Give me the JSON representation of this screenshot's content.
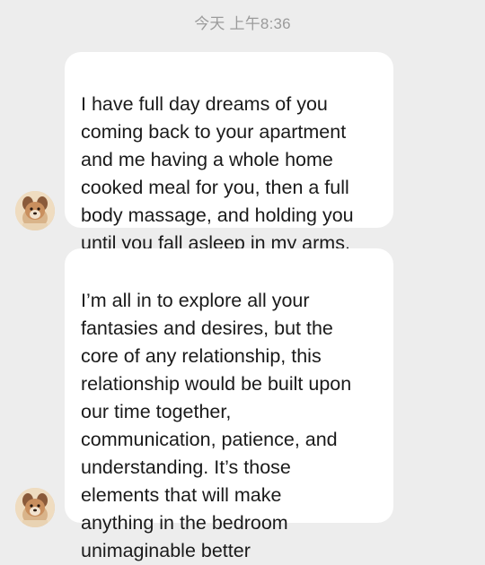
{
  "timestamp": "今天 上午8:36",
  "messages": [
    {
      "sender": "other",
      "avatar": "dog-avatar",
      "text": "I have full day dreams of you\ncoming back to your apartment\nand me having a whole home\ncooked meal for you, then a full\nbody massage, and holding you\nuntil you fall asleep in my arms."
    },
    {
      "sender": "other",
      "avatar": "dog-avatar",
      "text": "I’m all in to explore all your\nfantasies and desires, but the\ncore of any relationship, this\nrelationship would be built upon\nour time together,\ncommunication, patience, and\nunderstanding. It’s those\nelements that will make\nanything in the bedroom\nunimaginable better"
    }
  ],
  "colors": {
    "background": "#ededed",
    "bubble": "#ffffff",
    "text": "#1a1a1a",
    "timestamp": "#9b9b9b"
  }
}
